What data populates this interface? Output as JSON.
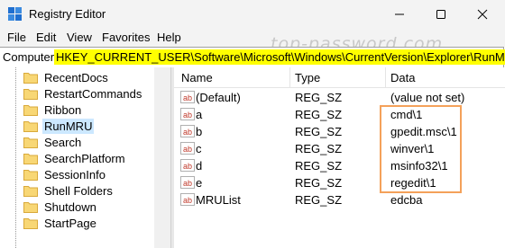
{
  "window": {
    "title": "Registry Editor"
  },
  "menu": [
    "File",
    "Edit",
    "View",
    "Favorites",
    "Help"
  ],
  "address": {
    "prefix": "Computer\\",
    "path": "HKEY_CURRENT_USER\\Software\\Microsoft\\Windows\\CurrentVersion\\Explorer\\RunMRU"
  },
  "watermark": "top-password.com",
  "tree": [
    {
      "label": "RecentDocs"
    },
    {
      "label": "RestartCommands"
    },
    {
      "label": "Ribbon"
    },
    {
      "label": "RunMRU",
      "selected": true
    },
    {
      "label": "Search"
    },
    {
      "label": "SearchPlatform"
    },
    {
      "label": "SessionInfo"
    },
    {
      "label": "Shell Folders"
    },
    {
      "label": "Shutdown"
    },
    {
      "label": "StartPage"
    }
  ],
  "columns": {
    "name": "Name",
    "type": "Type",
    "data": "Data"
  },
  "values": [
    {
      "name": "(Default)",
      "type": "REG_SZ",
      "data": "(value not set)",
      "icon": "string-value-icon"
    },
    {
      "name": "a",
      "type": "REG_SZ",
      "data": "cmd\\1",
      "icon": "string-value-icon"
    },
    {
      "name": "b",
      "type": "REG_SZ",
      "data": "gpedit.msc\\1",
      "icon": "string-value-icon"
    },
    {
      "name": "c",
      "type": "REG_SZ",
      "data": "winver\\1",
      "icon": "string-value-icon"
    },
    {
      "name": "d",
      "type": "REG_SZ",
      "data": "msinfo32\\1",
      "icon": "string-value-icon"
    },
    {
      "name": "e",
      "type": "REG_SZ",
      "data": "regedit\\1",
      "icon": "string-value-icon"
    },
    {
      "name": "MRUList",
      "type": "REG_SZ",
      "data": "edcba",
      "icon": "string-value-icon"
    }
  ],
  "colors": {
    "selection": "#cce8ff",
    "address_highlight": "#ffff00",
    "annotation_box": "#f4a15a",
    "folder": "#f8d775"
  }
}
